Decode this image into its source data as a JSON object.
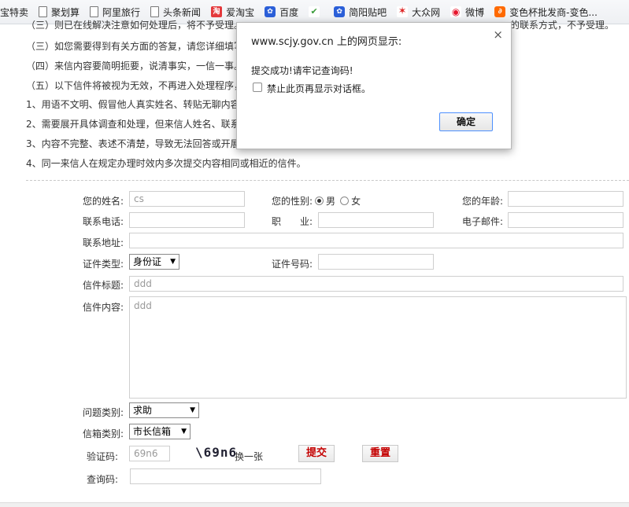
{
  "bookmarks": [
    {
      "label": "宝特卖",
      "icon": "none"
    },
    {
      "label": "聚划算",
      "icon": "page-icon"
    },
    {
      "label": "阿里旅行",
      "icon": "page-icon"
    },
    {
      "label": "头条新闻",
      "icon": "page-icon"
    },
    {
      "label": "爱淘宝",
      "icon": "taobao-icon",
      "glyph": "淘"
    },
    {
      "label": "百度",
      "icon": "baidu-paw-icon",
      "glyph": "✿"
    },
    {
      "label": "",
      "icon": "hao123-icon",
      "glyph": "✔"
    },
    {
      "label": "简阳贴吧",
      "icon": "tieba-paw-icon",
      "glyph": "✿"
    },
    {
      "label": "大众网",
      "icon": "dazhong-icon",
      "glyph": "✶"
    },
    {
      "label": "微博",
      "icon": "weibo-icon",
      "glyph": "◉"
    },
    {
      "label": "变色杯批发商-变色...",
      "icon": "alibaba-icon",
      "glyph": "∂"
    }
  ],
  "notice": {
    "line1_left": "（三）则已在线解决注意如何处理后，将不予受理。",
    "line1_right": "的联系方式，不予受理。",
    "line2": "（三）如您需要得到有关方面的答复，请您详细填写",
    "line3": "（四）来信内容要简明扼要，说清事实，一信一事。",
    "line4": "（五）以下信件将被视为无效，不再进入处理程序，本",
    "line5": "1、用语不文明、假冒他人真实姓名、转贴无聊内容、",
    "line6": "2、需要展开具体调查和处理，但来信人姓名、联系方",
    "line7": "3、内容不完整、表述不清楚，导致无法回答或开展调",
    "line8": "4、同一来信人在规定办理时效内多次提交内容相同或相近的信件。"
  },
  "form": {
    "name_label": "您的姓名:",
    "name_value": "cs",
    "gender_label": "您的性别:",
    "gender_male": "男",
    "gender_female": "女",
    "age_label": "您的年龄:",
    "age_value": "",
    "phone_label": "联系电话:",
    "phone_value": "",
    "job_label": "职　　业:",
    "job_value": "",
    "email_label": "电子邮件:",
    "email_value": "",
    "address_label": "联系地址:",
    "address_value": "",
    "id_type_label": "证件类型:",
    "id_type_value": "身份证",
    "id_no_label": "证件号码:",
    "id_no_value": "",
    "subject_label": "信件标题:",
    "subject_value": "ddd",
    "content_label": "信件内容:",
    "content_value": "ddd",
    "category_label": "问题类别:",
    "category_value": "求助",
    "mailbox_label": "信箱类别:",
    "mailbox_value": "市长信箱",
    "captcha_label": "验证码:",
    "captcha_value": "69n6",
    "captcha_image_text": "\\69n6",
    "captcha_refresh": "换一张",
    "submit_label": "提交",
    "reset_label": "重置",
    "query_label": "查询码:",
    "query_value": ""
  },
  "dialog": {
    "title": "www.scjy.gov.cn 上的网页显示:",
    "close": "×",
    "message": "提交成功!请牢记查询码!",
    "checkbox_label": "禁止此页再显示对话框。",
    "ok_label": "确定"
  }
}
